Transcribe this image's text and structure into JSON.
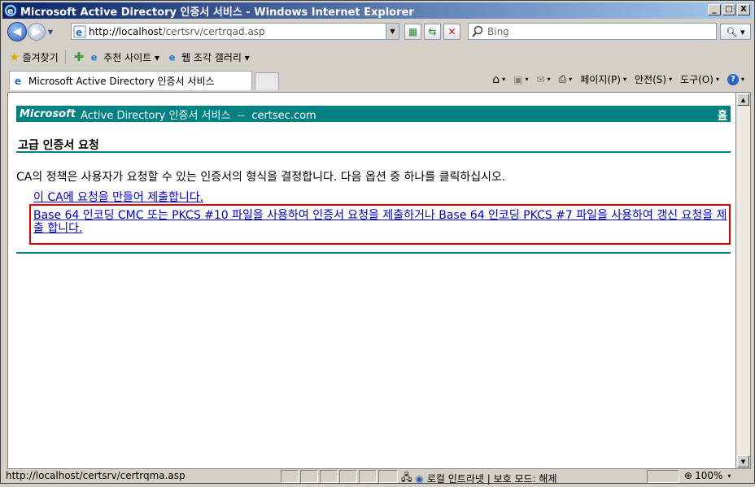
{
  "window": {
    "title": "Microsoft Active Directory 인증서 서비스 - Windows Internet Explorer",
    "minimize": "_",
    "maximize": "□",
    "close": "X"
  },
  "address": {
    "url_host": "http://localhost",
    "url_path": "/certsrv/certrqad.asp",
    "search_placeholder": "Bing"
  },
  "favorites": {
    "label": "즐겨찾기",
    "items": [
      "추천 사이트 ▾",
      "웹 조각 갤러리 ▾"
    ]
  },
  "tab": {
    "label": "Microsoft Active Directory 인증서 서비스"
  },
  "command_bar": {
    "page": "페이지(P)",
    "safety": "안전(S)",
    "tools": "도구(O)"
  },
  "page": {
    "header_brand": "Microsoft",
    "header_title": " Active Directory 인증서 서비스  --  certsec.com",
    "home_link": "홈",
    "section_title": "고급 인증서 요청",
    "description": "CA의 정책은 사용자가 요청할 수 있는 인증서의 형식을 결정합니다. 다음 옵션 중 하나를 클릭하십시오.",
    "link_create": "이 CA에 요청을 만들어 제출합니다.",
    "link_submit": "Base 64 인코딩 CMC 또는 PKCS #10 파일을 사용하여 인증서 요청을 제출하거나 Base 64 인코딩 PKCS #7 파일을 사용하여 갱신 요청을 제출 합니다."
  },
  "status": {
    "url": "http://localhost/certsrv/certrqma.asp",
    "zone": "로컬 인트라넷 | 보호 모드: 해제",
    "zoom": "100%"
  },
  "colors": {
    "teal": "#008080",
    "link": "#0000cc",
    "highlight_border": "#e00000"
  }
}
